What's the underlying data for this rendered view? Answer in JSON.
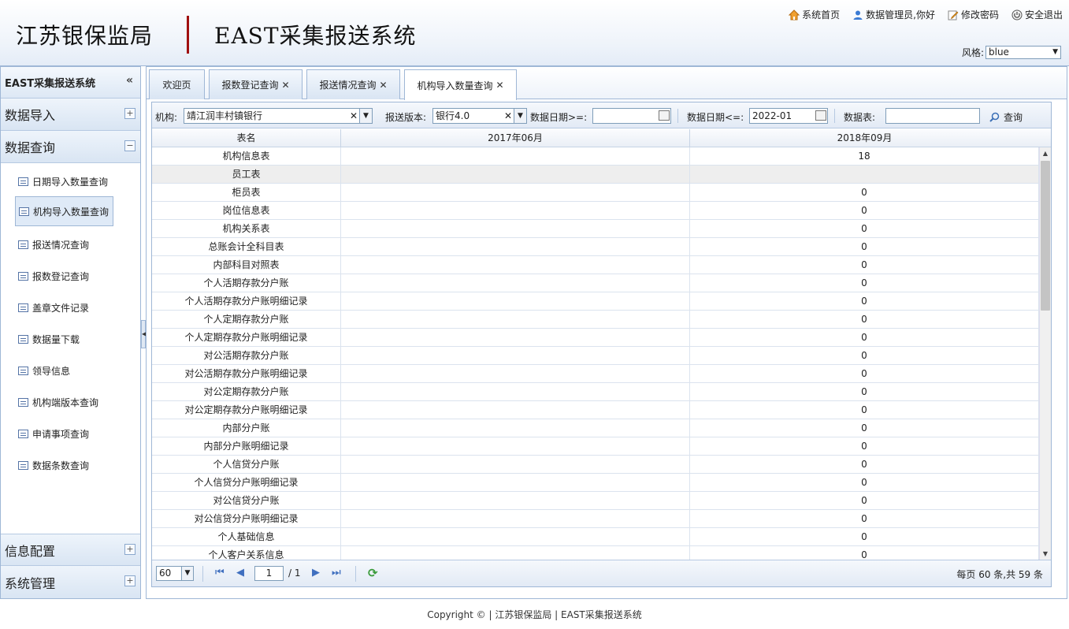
{
  "header": {
    "logo_left": "江苏银保监局",
    "logo_right": "EAST采集报送系统",
    "links": {
      "home": "系统首页",
      "user": "数据管理员,你好",
      "password": "修改密码",
      "logout": "安全退出"
    },
    "style_label": "风格:",
    "style_value": "blue"
  },
  "sidebar": {
    "title": "EAST采集报送系统",
    "collapse_glyph": "«",
    "groups": {
      "import": "数据导入",
      "query": "数据查询",
      "config": "信息配置",
      "system": "系统管理"
    },
    "items": [
      {
        "label": "日期导入数量查询"
      },
      {
        "label": "机构导入数量查询"
      },
      {
        "label": "报送情况查询"
      },
      {
        "label": "报数登记查询"
      },
      {
        "label": "盖章文件记录"
      },
      {
        "label": "数据量下载"
      },
      {
        "label": "领导信息"
      },
      {
        "label": "机构端版本查询"
      },
      {
        "label": "申请事项查询"
      },
      {
        "label": "数据条数查询"
      }
    ]
  },
  "tabs": [
    {
      "label": "欢迎页"
    },
    {
      "label": "报数登记查询"
    },
    {
      "label": "报送情况查询"
    },
    {
      "label": "机构导入数量查询"
    }
  ],
  "toolbar": {
    "org_label": "机构:",
    "org_value": "靖江润丰村镇银行",
    "version_label": "报送版本:",
    "version_value": "银行4.0",
    "date_from_label": "数据日期>=:",
    "date_from_value": "",
    "date_to_label": "数据日期<=:",
    "date_to_value": "2022-01",
    "table_label": "数据表:",
    "table_value": "",
    "query_label": "查询"
  },
  "grid": {
    "columns": [
      "表名",
      "2017年06月",
      "2018年09月"
    ],
    "rows": [
      [
        "机构信息表",
        "",
        "18"
      ],
      [
        "员工表",
        "",
        ""
      ],
      [
        "柜员表",
        "",
        "0"
      ],
      [
        "岗位信息表",
        "",
        "0"
      ],
      [
        "机构关系表",
        "",
        "0"
      ],
      [
        "总账会计全科目表",
        "",
        "0"
      ],
      [
        "内部科目对照表",
        "",
        "0"
      ],
      [
        "个人活期存款分户账",
        "",
        "0"
      ],
      [
        "个人活期存款分户账明细记录",
        "",
        "0"
      ],
      [
        "个人定期存款分户账",
        "",
        "0"
      ],
      [
        "个人定期存款分户账明细记录",
        "",
        "0"
      ],
      [
        "对公活期存款分户账",
        "",
        "0"
      ],
      [
        "对公活期存款分户账明细记录",
        "",
        "0"
      ],
      [
        "对公定期存款分户账",
        "",
        "0"
      ],
      [
        "对公定期存款分户账明细记录",
        "",
        "0"
      ],
      [
        "内部分户账",
        "",
        "0"
      ],
      [
        "内部分户账明细记录",
        "",
        "0"
      ],
      [
        "个人信贷分户账",
        "",
        "0"
      ],
      [
        "个人信贷分户账明细记录",
        "",
        "0"
      ],
      [
        "对公信贷分户账",
        "",
        "0"
      ],
      [
        "对公信贷分户账明细记录",
        "",
        "0"
      ],
      [
        "个人基础信息",
        "",
        "0"
      ],
      [
        "个人客户关系信息",
        "",
        "0"
      ]
    ]
  },
  "pager": {
    "page_size": "60",
    "current_page": "1",
    "total_pages": "/ 1",
    "info": "每页 60 条,共 59 条"
  },
  "footer": "Copyright © | 江苏银保监局 | EAST采集报送系统"
}
